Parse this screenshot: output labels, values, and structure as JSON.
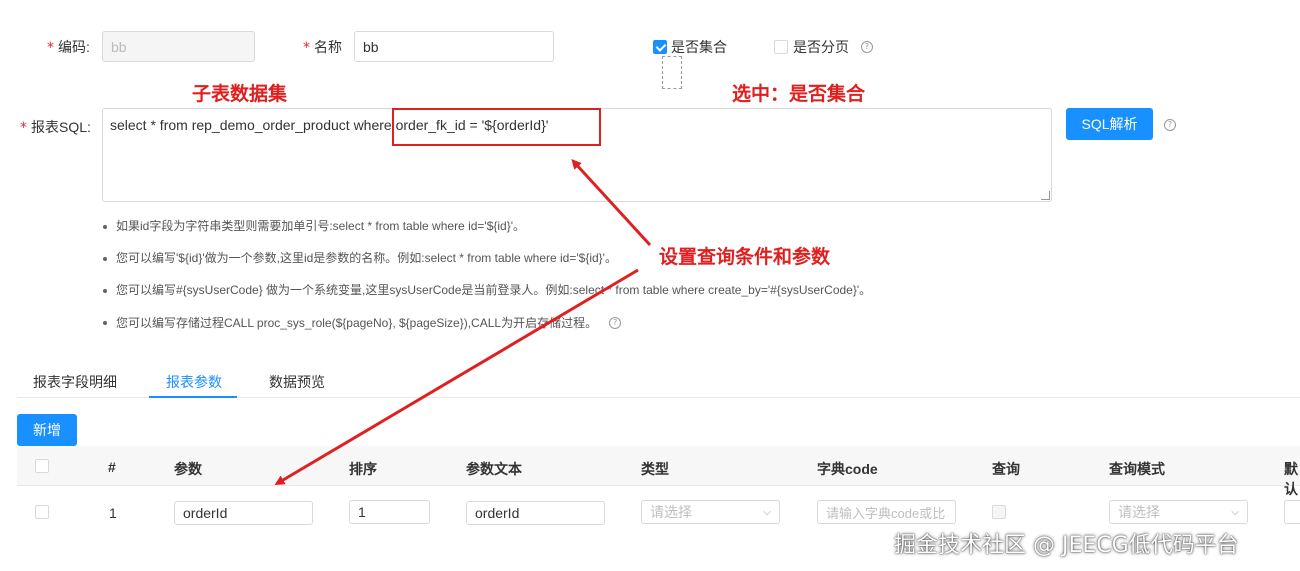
{
  "form": {
    "code_label": "编码:",
    "code_value": "bb",
    "name_label": "名称",
    "name_value": "bb",
    "is_collection_label": "是否集合",
    "is_collection_checked": true,
    "is_paging_label": "是否分页",
    "is_paging_checked": false,
    "sql_label": "报表SQL:",
    "sql_value": "select * from rep_demo_order_product where order_fk_id = '${orderId}'",
    "sql_parse_button": "SQL解析",
    "required_mark": "*"
  },
  "tips": [
    "如果id字段为字符串类型则需要加单引号:select * from table where id='${id}'。",
    "您可以编写'${id}'做为一个参数,这里id是参数的名称。例如:select * from table where id='${id}'。",
    "您可以编写#{sysUserCode} 做为一个系统变量,这里sysUserCode是当前登录人。例如:select * from table where create_by='#{sysUserCode}'。",
    "您可以编写存储过程CALL proc_sys_role(${pageNo}, ${pageSize}),CALL为开启存储过程。"
  ],
  "tabs": [
    {
      "label": "报表字段明细",
      "active": false
    },
    {
      "label": "报表参数",
      "active": true
    },
    {
      "label": "数据预览",
      "active": false
    }
  ],
  "add_button": "新增",
  "table": {
    "headers": [
      "#",
      "参数",
      "排序",
      "参数文本",
      "类型",
      "字典code",
      "查询",
      "查询模式",
      "默认"
    ],
    "rows": [
      {
        "index": "1",
        "param": "orderId",
        "order": "1",
        "param_text": "orderId",
        "type_placeholder": "请选择",
        "dict_placeholder": "请输入字典code或比",
        "query_checked": false,
        "query_mode_placeholder": "请选择"
      }
    ]
  },
  "annotations": {
    "sub_dataset": "子表数据集",
    "select_collection": "选中：是否集合",
    "set_conditions": "设置查询条件和参数"
  },
  "watermark": "掘金技术社区 @ JEECG低代码平台",
  "colors": {
    "primary": "#1890ff",
    "annotation_red": "#e02020",
    "required": "#f5222d"
  }
}
